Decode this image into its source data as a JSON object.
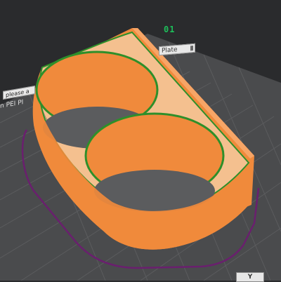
{
  "plate": {
    "number": "01",
    "name_label": "Plate",
    "lock_icon": "lock-icon"
  },
  "build_plate": {
    "label_hint": "please a",
    "label_type": "n PEI PI"
  },
  "corner_button": {
    "label": "Y"
  },
  "colors": {
    "background": "#2a2b2d",
    "plate": "#4a4b4d",
    "grid": "#5b5c5e",
    "outline": "#6a1f6e",
    "model": "#f08a3c",
    "model_top": "#f4c08f",
    "model_edge": "#2e8f2a"
  }
}
